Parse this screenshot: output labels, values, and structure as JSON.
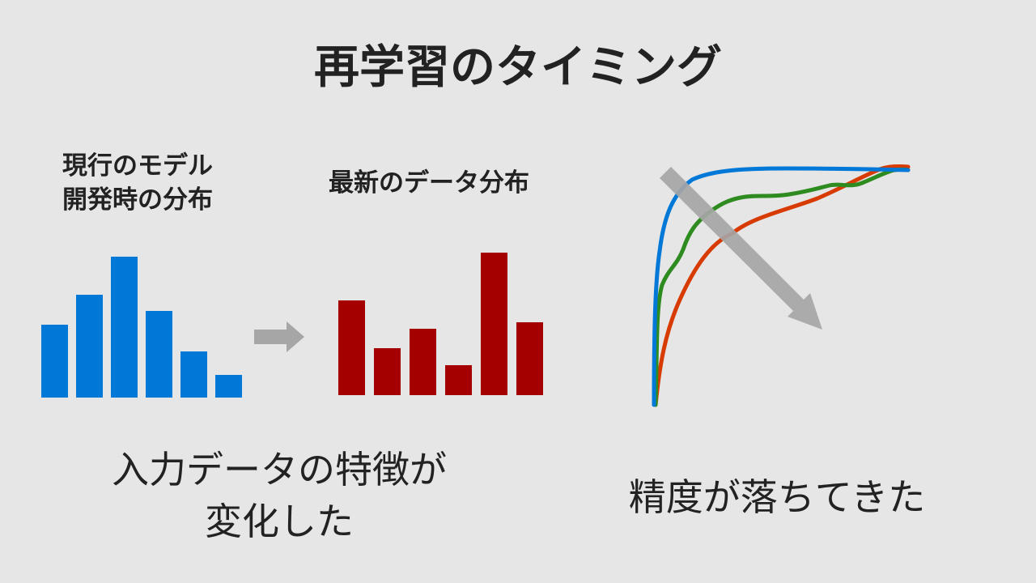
{
  "title": "再学習のタイミング",
  "current_distribution": {
    "label_line1": "現行のモデル",
    "label_line2": "開発時の分布",
    "color": "#0078d7"
  },
  "latest_distribution": {
    "label": "最新のデータ分布",
    "color": "#a50000"
  },
  "arrow_color": "#a6a6a6",
  "input_change": {
    "line1": "入力データの特徴が",
    "line2": "変化した"
  },
  "accuracy_drop": {
    "label": "精度が落ちてきた"
  },
  "chart_data": [
    {
      "type": "bar",
      "series": [
        {
          "values": [
            90,
            127,
            174,
            107,
            57,
            28
          ]
        }
      ],
      "color": "#0078d7"
    },
    {
      "type": "bar",
      "series": [
        {
          "values": [
            117,
            58,
            82,
            37,
            176,
            90
          ]
        }
      ],
      "color": "#a50000"
    },
    {
      "type": "line",
      "series": [
        {
          "color": "#0078d7",
          "description": "sharply rising curve"
        },
        {
          "color": "#2e8b20",
          "description": "moderately rising curve"
        },
        {
          "color": "#d83b01",
          "description": "gradually rising curve"
        }
      ]
    }
  ]
}
